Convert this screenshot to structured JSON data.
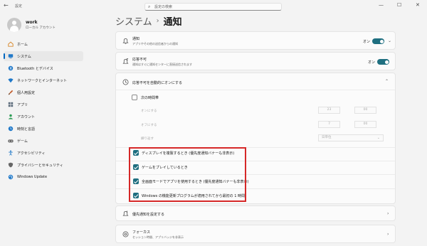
{
  "window": {
    "app_title": "設定",
    "back_glyph": "←",
    "minimize_glyph": "—",
    "maximize_glyph": "☐",
    "close_glyph": "✕"
  },
  "profile": {
    "name": "work",
    "account_type": "ローカル アカウント"
  },
  "search": {
    "placeholder": "設定の検索",
    "icon_glyph": "⌕"
  },
  "sidebar": {
    "items": [
      {
        "label": "ホーム",
        "icon": "home-icon",
        "color": "#d88a2e"
      },
      {
        "label": "システム",
        "icon": "system-icon",
        "color": "#1f78c8",
        "active": true
      },
      {
        "label": "Bluetooth とデバイス",
        "icon": "bluetooth-icon",
        "color": "#1f78c8"
      },
      {
        "label": "ネットワークとインターネット",
        "icon": "wifi-icon",
        "color": "#1f78c8"
      },
      {
        "label": "個人用設定",
        "icon": "brush-icon",
        "color": "#c25b2b"
      },
      {
        "label": "アプリ",
        "icon": "apps-icon",
        "color": "#5a6a7a"
      },
      {
        "label": "アカウント",
        "icon": "account-icon",
        "color": "#2e9d57"
      },
      {
        "label": "時刻と言語",
        "icon": "clock-globe-icon",
        "color": "#1f78c8"
      },
      {
        "label": "ゲーム",
        "icon": "game-icon",
        "color": "#666666"
      },
      {
        "label": "アクセシビリティ",
        "icon": "accessibility-icon",
        "color": "#1f78c8"
      },
      {
        "label": "プライバシーとセキュリティ",
        "icon": "shield-icon",
        "color": "#666666"
      },
      {
        "label": "Windows Update",
        "icon": "update-icon",
        "color": "#1f78c8"
      }
    ]
  },
  "breadcrumb": {
    "parent": "システム",
    "separator": "›",
    "current": "通知"
  },
  "notifications": {
    "title": "通知",
    "subtitle": "アプリやその他の送信者からの通知",
    "state": "オン",
    "chevron": "⌄"
  },
  "dnd": {
    "title": "応答不可",
    "subtitle": "通知はすぐに通知センターに直接送信されます",
    "state": "オン"
  },
  "auto_dnd": {
    "title": "応答不可を自動的にオンにする",
    "chevron": "⌃",
    "schedule": {
      "label": "次の時間帯",
      "on_label": "オンにする",
      "on_hour": "23",
      "on_minute": "00",
      "off_label": "オフにする",
      "off_hour": "7",
      "off_minute": "00",
      "repeat_label": "繰り返す",
      "repeat_value": "日単位",
      "repeat_arrow": "⌄"
    },
    "options": [
      {
        "label": "ディスプレイを複製するとき (優先度通知バナーも非表示)",
        "checked": true
      },
      {
        "label": "ゲームをプレイしているとき",
        "checked": true
      },
      {
        "label": "全画面モードでアプリを使用するとき (優先度通知バナーも非表示)",
        "checked": true
      },
      {
        "label": "Windows の機能更新プログラムが適用されてから最初の 1 時間",
        "checked": true
      }
    ]
  },
  "priority": {
    "title": "優先通知を設定する",
    "chevron": "›"
  },
  "focus": {
    "title": "フォーカス",
    "subtitle": "セッション時間、アプリバッジを非表示",
    "chevron": "›"
  },
  "colors": {
    "accent": "#1f6f80",
    "highlight": "#d62828",
    "nav_indicator": "#0067c0"
  }
}
